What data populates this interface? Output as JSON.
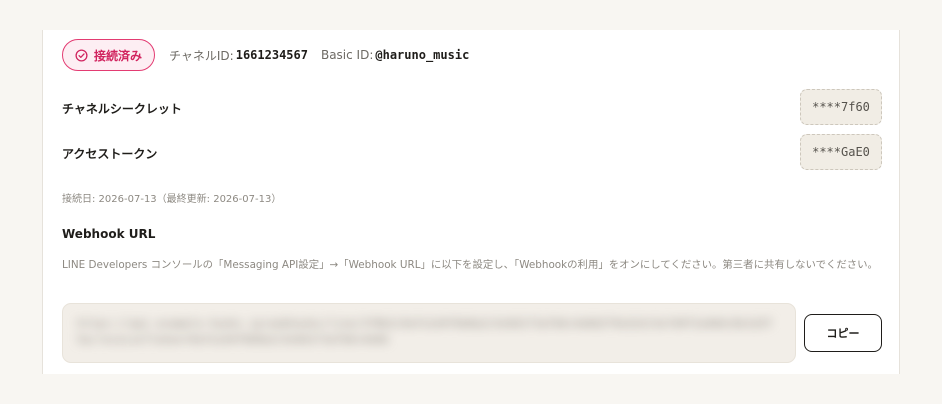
{
  "status": {
    "badge_label": "接続済み",
    "channel_id_label": "チャネルID:",
    "channel_id": "1661234567",
    "basic_id_label": "Basic ID:",
    "basic_id": "@haruno_music"
  },
  "credentials": [
    {
      "label": "チャネルシークレット",
      "value": "****7f60"
    },
    {
      "label": "アクセストークン",
      "value": "****GaE0"
    }
  ],
  "connected_date": "接続日: 2026-07-13（最終更新: 2026-07-13）",
  "webhook": {
    "title": "Webhook URL",
    "description": "LINE Developers コンソールの「Messaging API設定」→「Webhook URL」に以下を設定し、「Webhookの利用」をオンにしてください。第三者に共有しないでください。",
    "url_masked": "https://api.example-hooks.jp/webhooks/line/3f8b2c9a7e1d4f6b8a2c5e9d1f3a7b6c4e8d2f9a1b3c5e7d9f2a4b6c8e1d3f5a/receive?token=9a7e1d4f6b8a2c5e9d1f3a7b6c4e8d",
    "copy_label": "コピー"
  },
  "colors": {
    "accent": "#e33b72",
    "badge_bg": "#fdeef3",
    "muted_text": "#8d8982"
  }
}
